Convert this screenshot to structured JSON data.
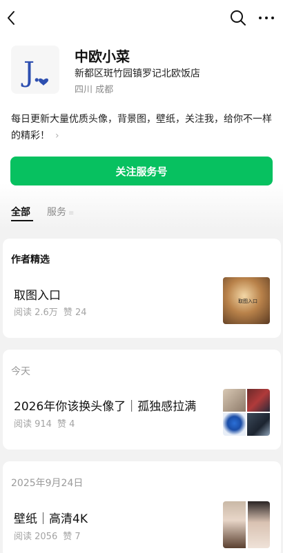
{
  "account": {
    "name": "中欧小菜",
    "address": "新都区斑竹园镇罗记北欧饭店",
    "city": "四川 成都",
    "avatar_text": "J."
  },
  "bio": {
    "text": "每日更新大量优质头像，背景图，壁纸，关注我，给你不一样的精彩！",
    "chevron": "›"
  },
  "follow_button": {
    "label": "关注服务号"
  },
  "tabs": [
    {
      "label": "全部",
      "active": true
    },
    {
      "label": "服务",
      "active": false,
      "icon": "≡"
    }
  ],
  "featured": {
    "heading": "作者精选",
    "article": {
      "title": "取图入口",
      "reads": "阅读 2.6万",
      "likes": "赞 24",
      "thumb_text": "取图入口"
    }
  },
  "sections": [
    {
      "date": "今天",
      "article": {
        "title": "2026年你该换头像了｜孤独感拉满",
        "reads": "阅读 914",
        "likes": "赞 4"
      }
    },
    {
      "date": "2025年9月24日",
      "article": {
        "title": "壁纸｜高清4K",
        "reads": "阅读 2056",
        "likes": "赞 7"
      }
    }
  ],
  "colors": {
    "accent": "#07c160",
    "background": "#f2f2f2",
    "muted": "#a3a3a3"
  },
  "icons": {
    "back": "back-arrow-icon",
    "search": "search-icon",
    "more": "more-dots-icon"
  }
}
